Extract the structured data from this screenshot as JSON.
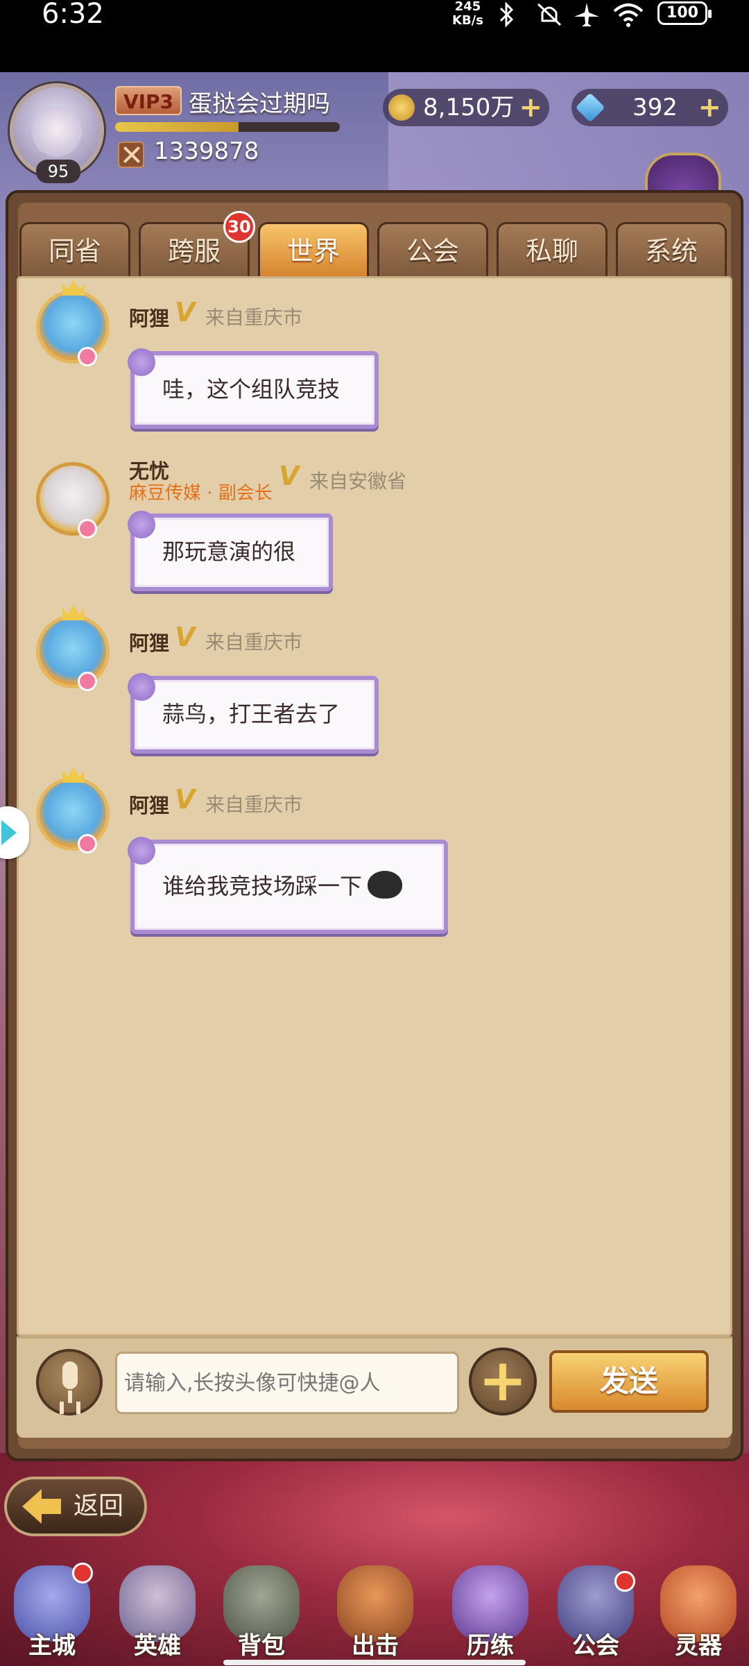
{
  "status_bar": {
    "time": "6:32",
    "net_speed": "245",
    "net_unit": "KB/s",
    "battery": "100"
  },
  "header": {
    "level": "95",
    "vip": "VIP3",
    "player_name": "蛋挞会过期吗",
    "power": "1339878",
    "gold": "8,150万",
    "diamonds": "392",
    "xp_fraction": 0.55
  },
  "tabs": [
    {
      "label": "同省"
    },
    {
      "label": "跨服",
      "badge": "30"
    },
    {
      "label": "世界",
      "active": true
    },
    {
      "label": "公会"
    },
    {
      "label": "私聊"
    },
    {
      "label": "系统"
    }
  ],
  "messages": [
    {
      "name": "阿狸",
      "from": "来自重庆市",
      "text": "哇，这个组队竞技"
    },
    {
      "name": "无忧",
      "guild": "麻豆传媒 · 副会长",
      "from": "来自安徽省",
      "text": "那玩意演的很"
    },
    {
      "name": "阿狸",
      "from": "来自重庆市",
      "text": "蒜鸟，打王者去了"
    },
    {
      "name": "阿狸",
      "from": "来自重庆市",
      "text": "谁给我竞技场踩一下"
    }
  ],
  "input": {
    "placeholder": "请输入,长按头像可快捷@人",
    "send_label": "发送"
  },
  "back_label": "返回",
  "bottom_nav": [
    {
      "label": "主城"
    },
    {
      "label": "英雄"
    },
    {
      "label": "背包"
    },
    {
      "label": "出击"
    },
    {
      "label": "历练"
    },
    {
      "label": "公会"
    },
    {
      "label": "灵器"
    }
  ],
  "colors": {
    "accent": "#d88a2c",
    "bubble_border": "#a88bd0",
    "panel_bg": "#e2cfa9",
    "badge_red": "#e0342f"
  }
}
